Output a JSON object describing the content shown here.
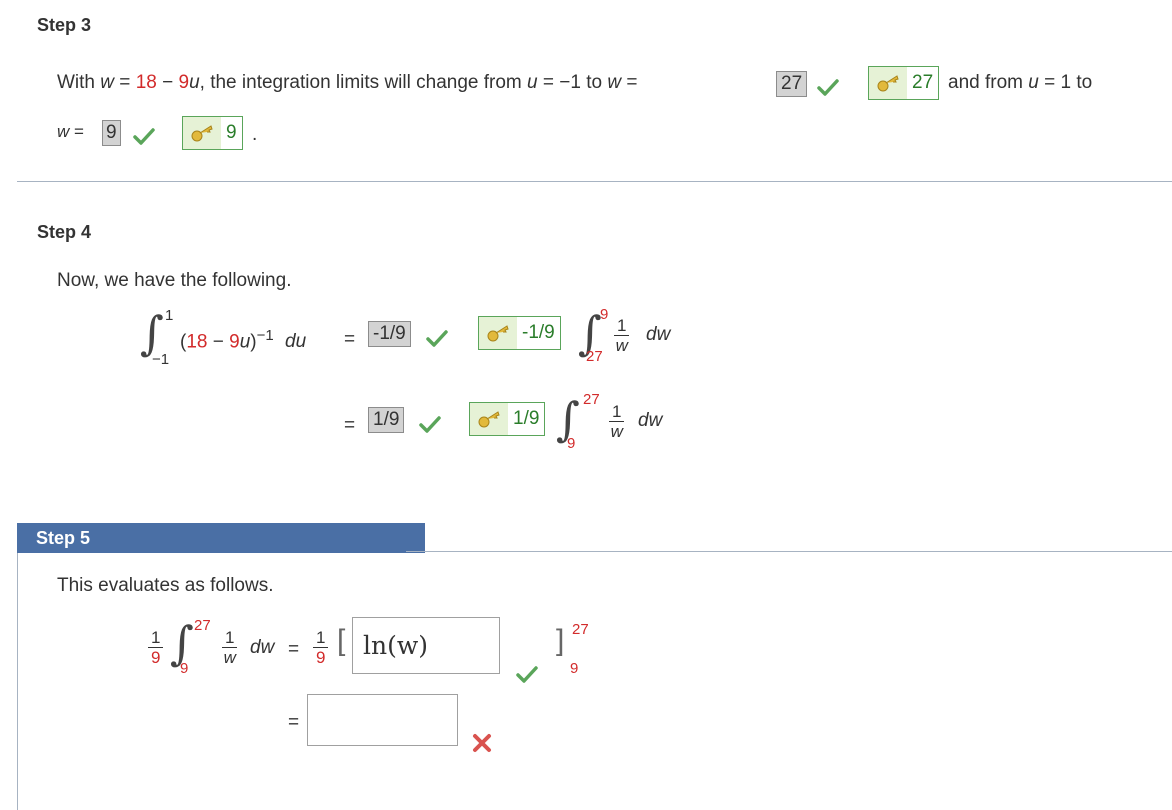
{
  "step3": {
    "title": "Step 3",
    "text_with": "With",
    "var_w": "w",
    "eq": "=",
    "num18": "18",
    "minus": "−",
    "term9u": "9",
    "var_u": "u",
    "comma_text": ", the integration limits will change from",
    "u_eq_neg1": "= −1 to",
    "answer1": "27",
    "key1": "27",
    "and_from": "and from",
    "u_eq_1_to": "= 1 to",
    "answer2": "9",
    "key2": "9",
    "period": "."
  },
  "step4": {
    "title": "Step 4",
    "intro": "Now, we have the following.",
    "lower1": "−1",
    "upper1": "1",
    "integrand_open": "(18 − 9",
    "integrand_close": ")",
    "exponent": "−1",
    "du": "du",
    "eq": "=",
    "answer1": "-1/9",
    "key1": "-1/9",
    "lower2": "27",
    "upper2": "9",
    "frac_num": "1",
    "frac_den": "w",
    "dw": "dw",
    "answer2": "1/9",
    "key2": "1/9",
    "lower3": "9",
    "upper3": "27"
  },
  "step5": {
    "title": "Step 5",
    "intro": "This evaluates as follows.",
    "coef_num": "1",
    "coef_den": "9",
    "upper": "27",
    "lower": "9",
    "frac_num": "1",
    "frac_den": "w",
    "dw": "dw",
    "eq": "=",
    "input1_value": "ln(w)",
    "input2_value": "",
    "bracket_upper": "27",
    "bracket_lower": "9"
  },
  "colors": {
    "accent_red": "#d22b2b",
    "correct_green": "#5aa55a",
    "wrong_red": "#d9534f",
    "step5_header": "#4a6fa5"
  },
  "icons": {
    "correct": "checkmark-icon",
    "incorrect": "cross-icon",
    "key": "key-icon"
  }
}
